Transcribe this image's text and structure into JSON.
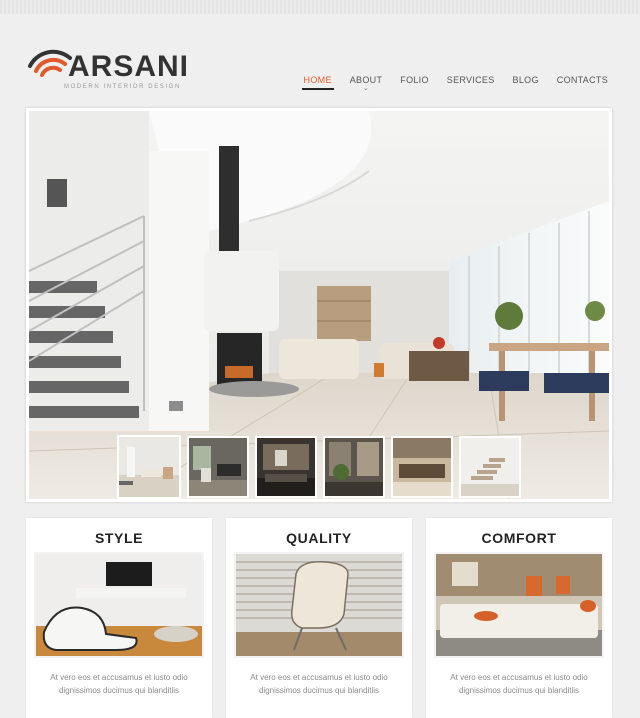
{
  "brand": {
    "name": "ARSANI",
    "tagline": "MODERN INTERIOR DESIGN",
    "accent": "#e05a2b"
  },
  "nav": {
    "items": [
      {
        "label": "HOME",
        "active": true
      },
      {
        "label": "ABOUT",
        "has_dropdown": true
      },
      {
        "label": "FOLIO"
      },
      {
        "label": "SERVICES"
      },
      {
        "label": "BLOG"
      },
      {
        "label": "CONTACTS"
      }
    ]
  },
  "slider": {
    "image": "interior-living-room-staircase",
    "thumbnails": [
      "thumb-living-room",
      "thumb-dining-area",
      "thumb-lounge",
      "thumb-hallway-plants",
      "thumb-kitchen",
      "thumb-staircase"
    ]
  },
  "features": [
    {
      "title": "STYLE",
      "image": "white-lounge-chair",
      "text": "At vero eos et accusamus et iusto odio dignissimos ducimus qui blanditiis"
    },
    {
      "title": "QUALITY",
      "image": "cream-armchair-blinds",
      "text": "At vero eos et accusamus et iusto odio dignissimos ducimus qui blanditiis"
    },
    {
      "title": "COMFORT",
      "image": "white-sectional-sofa",
      "text": "At vero eos et accusamus et iusto odio dignissimos ducimus qui blanditiis"
    }
  ]
}
